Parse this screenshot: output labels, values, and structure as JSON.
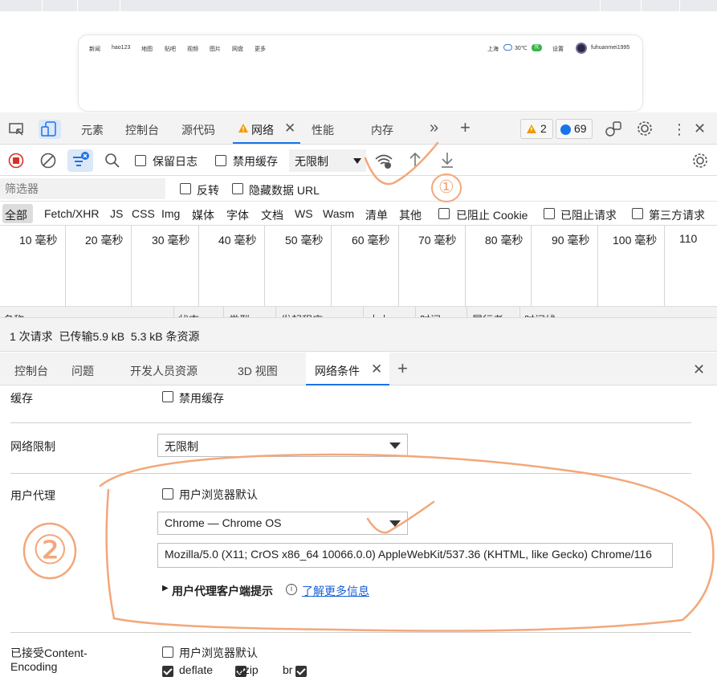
{
  "browser": {
    "nav_links": [
      "新闻",
      "hao123",
      "地图",
      "贴吧",
      "视频",
      "图片",
      "网盘",
      "更多"
    ],
    "city": "上海",
    "temp": "30℃",
    "air": "优",
    "settings": "设置",
    "username": "fuhuanmei1995"
  },
  "devtools": {
    "tabs": {
      "elements": "元素",
      "console": "控制台",
      "sources": "源代码",
      "network": "网络",
      "performance": "性能",
      "memory": "内存"
    },
    "warnings_count": "2",
    "messages_count": "69"
  },
  "toolbar": {
    "preserve_log": "保留日志",
    "disable_cache": "禁用缓存",
    "throttle": "无限制"
  },
  "filter": {
    "placeholder": "筛选器",
    "invert": "反转",
    "hide_data_urls": "隐藏数据 URL"
  },
  "types": [
    "全部",
    "Fetch/XHR",
    "JS",
    "CSS",
    "Img",
    "媒体",
    "字体",
    "文档",
    "WS",
    "Wasm",
    "清单",
    "其他"
  ],
  "type_checks": [
    "已阻止 Cookie",
    "已阻止请求",
    "第三方请求"
  ],
  "timeline_ticks": [
    "10 毫秒",
    "20 毫秒",
    "30 毫秒",
    "40 毫秒",
    "50 毫秒",
    "60 毫秒",
    "70 毫秒",
    "80 毫秒",
    "90 毫秒",
    "100 毫秒",
    "110"
  ],
  "table_headers": [
    "名称",
    "状态",
    "类型",
    "发起程序",
    "大小",
    "时间",
    "履行者",
    "时间线"
  ],
  "status": "1 次请求  已传输5.9 kB  5.3 kB 条资源",
  "drawer": {
    "tabs": {
      "console": "控制台",
      "issues": "问题",
      "developer_resources": "开发人员资源",
      "view3d": "3D 视图",
      "network_conditions": "网络条件"
    }
  },
  "network_conditions": {
    "cache_label": "缓存",
    "cache_checkbox": "禁用缓存",
    "throttling_label": "网络限制",
    "throttling_value": "无限制",
    "ua_label": "用户代理",
    "ua_default": "用户浏览器默认",
    "ua_select": "Chrome — Chrome OS",
    "ua_string": "Mozilla/5.0 (X11; CrOS x86_64 10066.0.0) AppleWebKit/537.36 (KHTML, like Gecko) Chrome/116",
    "client_hints": "用户代理客户端提示",
    "learn_more": "了解更多信息",
    "encoding_label_1": "已接受Content-",
    "encoding_label_2": "Encoding",
    "encoding_default": "用户浏览器默认",
    "encodings": [
      "deflate",
      "gzip",
      "br"
    ]
  },
  "annotations": {
    "mark1": "①",
    "mark2": "②",
    "color": "#f3a77a"
  },
  "colors": {
    "accent": "#1a73e8",
    "record": "#d93025",
    "warning": "#f29900",
    "message": "#1a73e8"
  }
}
